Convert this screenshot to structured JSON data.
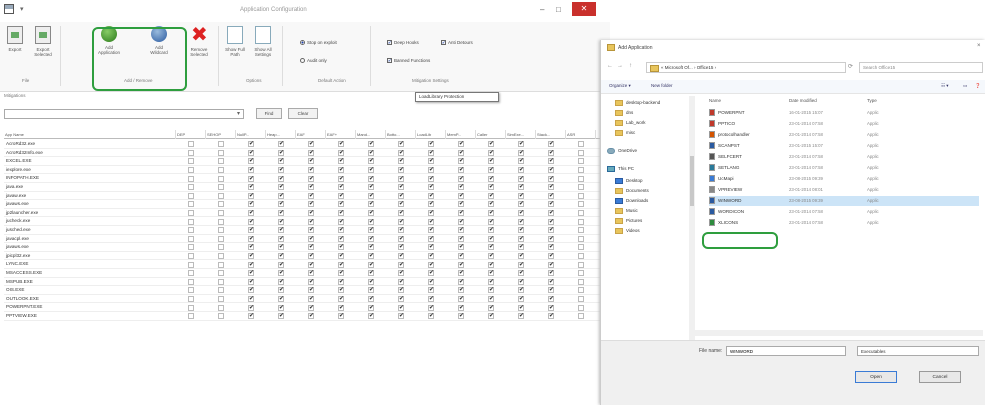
{
  "window": {
    "title": "Application Configuration",
    "qat": "▾",
    "min": "–",
    "max": "□",
    "close": "✕"
  },
  "ribbon": {
    "buttons": [
      {
        "label": "Export",
        "icon": "export-icon"
      },
      {
        "label": "Export Selected",
        "icon": "export-selected-icon"
      },
      {
        "label": "Add Application",
        "icon": "add-application-icon"
      },
      {
        "label": "Add Wildcard",
        "icon": "add-wildcard-icon"
      },
      {
        "label": "Remove Selected",
        "icon": "remove-icon"
      },
      {
        "label": "Show Full Path",
        "icon": "show-full-path-icon"
      },
      {
        "label": "Show All Settings",
        "icon": "show-all-settings-icon"
      }
    ],
    "groups": {
      "file": "File",
      "add_remove": "Add / Remove",
      "options": "Options",
      "default_action": "Default Action",
      "mitigation_settings": "Mitigation Settings"
    },
    "options": {
      "stop_on_exploit": "Stop on exploit",
      "audit_only": "Audit only",
      "deep_hooks": "Deep Hooks",
      "anti_detours": "Anti Detours",
      "banned_functions": "Banned Functions"
    },
    "tooltip": "LoadLibrary Protection"
  },
  "mitigations_label": "Mitigations",
  "filter": {
    "value": "",
    "find_label": "Find",
    "clear_label": "Clear"
  },
  "grid": {
    "name_header": "App Name",
    "columns": [
      "DEP",
      "SEHOP",
      "NullP...",
      "Heap...",
      "EAF",
      "EAF+",
      "Mand...",
      "Botto...",
      "LoadLib",
      "MemP...",
      "Caller",
      "SimExe...",
      "Stack...",
      "ASR"
    ],
    "rows": [
      {
        "name": "AcroRd32.exe",
        "checks": [
          0,
          0,
          1,
          1,
          1,
          1,
          1,
          1,
          1,
          1,
          1,
          1,
          1,
          0
        ]
      },
      {
        "name": "AcroRd32Info.exe",
        "checks": [
          0,
          0,
          1,
          1,
          1,
          1,
          1,
          1,
          1,
          1,
          1,
          1,
          1,
          0
        ]
      },
      {
        "name": "EXCEL.EXE",
        "checks": [
          0,
          0,
          1,
          1,
          1,
          1,
          1,
          1,
          1,
          1,
          1,
          1,
          1,
          0
        ]
      },
      {
        "name": "iexplore.exe",
        "checks": [
          0,
          0,
          1,
          1,
          1,
          1,
          1,
          1,
          1,
          1,
          1,
          1,
          1,
          0
        ]
      },
      {
        "name": "INFOPATH.EXE",
        "checks": [
          0,
          0,
          1,
          1,
          1,
          1,
          1,
          1,
          1,
          1,
          1,
          1,
          1,
          0
        ]
      },
      {
        "name": "java.exe",
        "checks": [
          0,
          0,
          1,
          1,
          1,
          1,
          1,
          1,
          1,
          1,
          1,
          1,
          1,
          0
        ]
      },
      {
        "name": "javaw.exe",
        "checks": [
          0,
          0,
          1,
          1,
          1,
          1,
          1,
          1,
          1,
          1,
          1,
          1,
          1,
          0
        ]
      },
      {
        "name": "javaws.exe",
        "checks": [
          0,
          0,
          1,
          1,
          1,
          1,
          1,
          1,
          1,
          1,
          1,
          1,
          1,
          0
        ]
      },
      {
        "name": "jp2launcher.exe",
        "checks": [
          0,
          0,
          1,
          1,
          1,
          1,
          1,
          1,
          1,
          1,
          1,
          1,
          1,
          0
        ]
      },
      {
        "name": "jucheck.exe",
        "checks": [
          0,
          0,
          1,
          1,
          1,
          1,
          1,
          1,
          1,
          1,
          1,
          1,
          1,
          0
        ]
      },
      {
        "name": "jusched.exe",
        "checks": [
          0,
          0,
          1,
          1,
          1,
          1,
          1,
          1,
          1,
          1,
          1,
          1,
          1,
          0
        ]
      },
      {
        "name": "javacpl.exe",
        "checks": [
          0,
          0,
          1,
          1,
          1,
          1,
          1,
          1,
          1,
          1,
          1,
          1,
          1,
          0
        ]
      },
      {
        "name": "javaws.exe",
        "checks": [
          0,
          0,
          1,
          1,
          1,
          1,
          1,
          1,
          1,
          1,
          1,
          1,
          1,
          0
        ]
      },
      {
        "name": "jpicpl32.exe",
        "checks": [
          0,
          0,
          1,
          1,
          1,
          1,
          1,
          1,
          1,
          1,
          1,
          1,
          1,
          0
        ]
      },
      {
        "name": "LYNC.EXE",
        "checks": [
          0,
          0,
          1,
          1,
          1,
          1,
          1,
          1,
          1,
          1,
          1,
          1,
          1,
          0
        ]
      },
      {
        "name": "MSACCESS.EXE",
        "checks": [
          0,
          0,
          1,
          1,
          1,
          1,
          1,
          1,
          1,
          1,
          1,
          1,
          1,
          0
        ]
      },
      {
        "name": "MSPUB.EXE",
        "checks": [
          0,
          0,
          1,
          1,
          1,
          1,
          1,
          1,
          1,
          1,
          1,
          1,
          1,
          0
        ]
      },
      {
        "name": "OIS.EXE",
        "checks": [
          0,
          0,
          1,
          1,
          1,
          1,
          1,
          1,
          1,
          1,
          1,
          1,
          1,
          0
        ]
      },
      {
        "name": "OUTLOOK.EXE",
        "checks": [
          0,
          0,
          1,
          1,
          1,
          1,
          1,
          1,
          1,
          1,
          1,
          1,
          1,
          0
        ]
      },
      {
        "name": "POWERPNT.EXE",
        "checks": [
          0,
          0,
          1,
          1,
          1,
          1,
          1,
          1,
          1,
          1,
          1,
          1,
          1,
          0
        ]
      },
      {
        "name": "PPTVIEW.EXE",
        "checks": [
          0,
          0,
          1,
          1,
          1,
          1,
          1,
          1,
          1,
          1,
          1,
          1,
          1,
          0
        ]
      }
    ]
  },
  "dialog": {
    "title": "Add Application",
    "close": "×",
    "address": "« Microsoft Of... › Office15 ›",
    "search_placeholder": "Search Office15",
    "organize": "Organize ▾",
    "new_folder": "New folder",
    "nav_items": [
      {
        "label": "desktop-backend",
        "type": "folder"
      },
      {
        "label": "dns",
        "type": "folder"
      },
      {
        "label": "Lab_work",
        "type": "folder"
      },
      {
        "label": "misc",
        "type": "folder"
      },
      {
        "label": "OneDrive",
        "type": "cloud"
      },
      {
        "label": "This PC",
        "type": "pc"
      },
      {
        "label": "Desktop",
        "type": "blue"
      },
      {
        "label": "Documents",
        "type": "folder"
      },
      {
        "label": "Downloads",
        "type": "blue"
      },
      {
        "label": "Music",
        "type": "folder"
      },
      {
        "label": "Pictures",
        "type": "folder"
      },
      {
        "label": "Videos",
        "type": "folder"
      }
    ],
    "col_name": "Name",
    "col_date": "Date modified",
    "col_type": "Type",
    "files": [
      {
        "name": "POWERPNT",
        "date": "16-01-2015 15:07",
        "type": "Applic"
      },
      {
        "name": "PPTICO",
        "date": "23-01-2014 07:58",
        "type": "Applic"
      },
      {
        "name": "protocolhandler",
        "date": "23-01-2014 07:58",
        "type": "Applic"
      },
      {
        "name": "SCANPST",
        "date": "23-01-2015 15:07",
        "type": "Applic"
      },
      {
        "name": "SELFCERT",
        "date": "23-01-2014 07:58",
        "type": "Applic"
      },
      {
        "name": "SETLANG",
        "date": "23-01-2014 07:58",
        "type": "Applic"
      },
      {
        "name": "UcMapi",
        "date": "23-08-2015 09:39",
        "type": "Applic"
      },
      {
        "name": "VPREVIEW",
        "date": "23-01-2014 08:01",
        "type": "Applic"
      },
      {
        "name": "WINWORD",
        "date": "23-08-2015 09:39",
        "type": "Applic"
      },
      {
        "name": "WORDICON",
        "date": "23-01-2014 07:58",
        "type": "Applic"
      },
      {
        "name": "XLICONS",
        "date": "23-01-2014 07:58",
        "type": "Applic"
      }
    ],
    "filename_label": "File name:",
    "filename_value": "WINWORD",
    "filetype": "Executables",
    "open_label": "Open",
    "cancel_label": "Cancel"
  }
}
